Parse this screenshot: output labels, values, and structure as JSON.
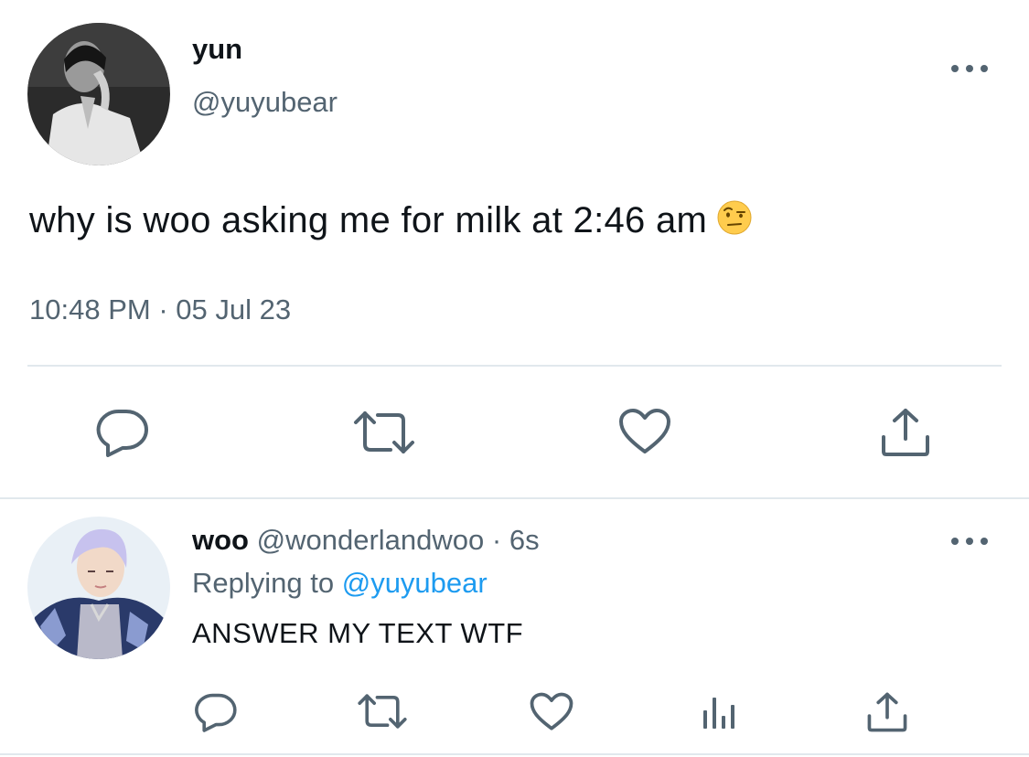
{
  "main_tweet": {
    "display_name": "yun",
    "handle": "@yuyubear",
    "text": "why is woo asking me for milk at 2:46 am",
    "emoji": "face-with-raised-eyebrow",
    "time": "10:48 PM",
    "separator": "·",
    "date": "05 Jul 23",
    "actions": [
      "reply-icon",
      "retweet-icon",
      "like-icon",
      "share-icon"
    ]
  },
  "reply_tweet": {
    "display_name": "woo",
    "handle": "@wonderlandwoo",
    "separator": "·",
    "relative_time": "6s",
    "replying_prefix": "Replying to",
    "replying_handle": "@yuyubear",
    "text": "ANSWER MY TEXT WTF",
    "actions": [
      "reply-icon",
      "retweet-icon",
      "like-icon",
      "analytics-icon",
      "share-icon"
    ]
  },
  "colors": {
    "text_primary": "#0f1419",
    "text_secondary": "#536471",
    "link": "#1d9bf0",
    "divider": "#e1e8ed"
  }
}
